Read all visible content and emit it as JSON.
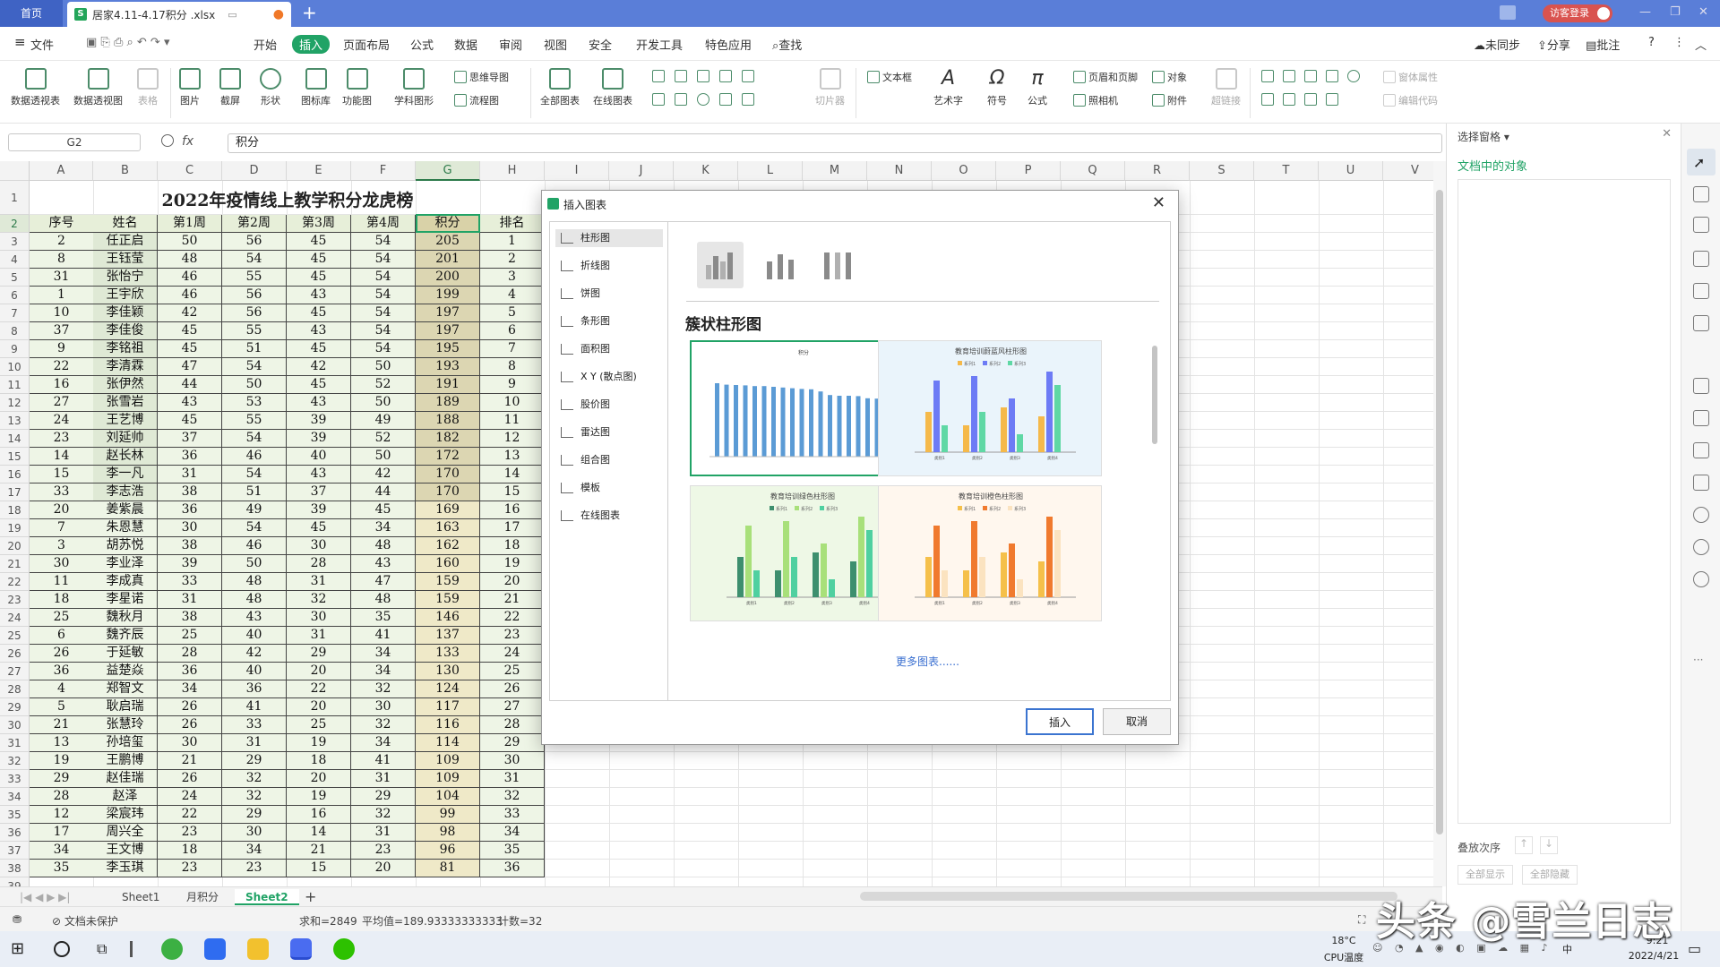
{
  "titlebar": {
    "home_tab": "首页",
    "file_tab": "居家4.11-4.17积分 .xlsx",
    "xls_glyph": "S",
    "login": "访客登录"
  },
  "menu": [
    "文件",
    "开始",
    "插入",
    "页面布局",
    "公式",
    "数据",
    "审阅",
    "视图",
    "安全",
    "开发工具",
    "特色应用",
    "查找"
  ],
  "menu_right": [
    "未同步",
    "分享",
    "批注"
  ],
  "ribbon": {
    "big": [
      "数据透视表",
      "数据透视图",
      "表格",
      "图片",
      "截屏",
      "形状",
      "图标库",
      "功能图",
      "学科图形",
      "全部图表",
      "在线图表",
      "切片器",
      "艺术字",
      "符号",
      "公式",
      "超链接"
    ],
    "small": [
      "思维导图",
      "流程图",
      "文本框",
      "页眉和页脚",
      "照相机",
      "对象",
      "附件",
      "窗体属性",
      "编辑代码"
    ]
  },
  "formula": {
    "namebox": "G2",
    "fx": "fx",
    "value": "积分"
  },
  "sheet": {
    "columns": [
      "A",
      "B",
      "C",
      "D",
      "E",
      "F",
      "G",
      "H",
      "I",
      "J",
      "K",
      "L",
      "M",
      "N",
      "O",
      "P",
      "Q",
      "R",
      "S",
      "T",
      "U",
      "V"
    ],
    "title": "2022年疫情线上教学积分龙虎榜",
    "headers": [
      "序号",
      "姓名",
      "第1周",
      "第2周",
      "第3周",
      "第4周",
      "积分",
      "排名"
    ],
    "rows": [
      [
        "2",
        "任正启",
        "50",
        "56",
        "45",
        "54",
        "205",
        "1"
      ],
      [
        "8",
        "王钰莹",
        "48",
        "54",
        "45",
        "54",
        "201",
        "2"
      ],
      [
        "31",
        "张怡宁",
        "46",
        "55",
        "45",
        "54",
        "200",
        "3"
      ],
      [
        "1",
        "王宇欣",
        "46",
        "56",
        "43",
        "54",
        "199",
        "4"
      ],
      [
        "10",
        "李佳颖",
        "42",
        "56",
        "45",
        "54",
        "197",
        "5"
      ],
      [
        "37",
        "李佳俊",
        "45",
        "55",
        "43",
        "54",
        "197",
        "6"
      ],
      [
        "9",
        "李铭祖",
        "45",
        "51",
        "45",
        "54",
        "195",
        "7"
      ],
      [
        "22",
        "李清霖",
        "47",
        "54",
        "42",
        "50",
        "193",
        "8"
      ],
      [
        "16",
        "张伊然",
        "44",
        "50",
        "45",
        "52",
        "191",
        "9"
      ],
      [
        "27",
        "张雪岩",
        "43",
        "53",
        "43",
        "50",
        "189",
        "10"
      ],
      [
        "24",
        "王艺博",
        "45",
        "55",
        "39",
        "49",
        "188",
        "11"
      ],
      [
        "23",
        "刘延帅",
        "37",
        "54",
        "39",
        "52",
        "182",
        "12"
      ],
      [
        "14",
        "赵长林",
        "36",
        "46",
        "40",
        "50",
        "172",
        "13"
      ],
      [
        "15",
        "李一凡",
        "31",
        "54",
        "43",
        "42",
        "170",
        "14"
      ],
      [
        "33",
        "李志浩",
        "38",
        "51",
        "37",
        "44",
        "170",
        "15"
      ],
      [
        "20",
        "姜紫晨",
        "36",
        "49",
        "39",
        "45",
        "169",
        "16"
      ],
      [
        "7",
        "朱恩慧",
        "30",
        "54",
        "45",
        "34",
        "163",
        "17"
      ],
      [
        "3",
        "胡苏悦",
        "38",
        "46",
        "30",
        "48",
        "162",
        "18"
      ],
      [
        "30",
        "李业泽",
        "39",
        "50",
        "28",
        "43",
        "160",
        "19"
      ],
      [
        "11",
        "李成真",
        "33",
        "48",
        "31",
        "47",
        "159",
        "20"
      ],
      [
        "18",
        "李星诺",
        "31",
        "48",
        "32",
        "48",
        "159",
        "21"
      ],
      [
        "25",
        "魏秋月",
        "38",
        "43",
        "30",
        "35",
        "146",
        "22"
      ],
      [
        "6",
        "魏齐辰",
        "25",
        "40",
        "31",
        "41",
        "137",
        "23"
      ],
      [
        "26",
        "于延敏",
        "28",
        "42",
        "29",
        "34",
        "133",
        "24"
      ],
      [
        "36",
        "益楚焱",
        "36",
        "40",
        "20",
        "34",
        "130",
        "25"
      ],
      [
        "4",
        "郑智文",
        "34",
        "36",
        "22",
        "32",
        "124",
        "26"
      ],
      [
        "5",
        "耿启瑞",
        "26",
        "41",
        "20",
        "30",
        "117",
        "27"
      ],
      [
        "21",
        "张慧玲",
        "26",
        "33",
        "25",
        "32",
        "116",
        "28"
      ],
      [
        "13",
        "孙培玺",
        "30",
        "31",
        "19",
        "34",
        "114",
        "29"
      ],
      [
        "19",
        "王鹏博",
        "21",
        "29",
        "18",
        "41",
        "109",
        "30"
      ],
      [
        "29",
        "赵佳瑞",
        "26",
        "32",
        "20",
        "31",
        "109",
        "31"
      ],
      [
        "28",
        "赵泽",
        "24",
        "32",
        "19",
        "29",
        "104",
        "32"
      ],
      [
        "12",
        "梁宸玮",
        "22",
        "29",
        "16",
        "32",
        "99",
        "33"
      ],
      [
        "17",
        "周兴全",
        "23",
        "30",
        "14",
        "31",
        "98",
        "34"
      ],
      [
        "34",
        "王文博",
        "18",
        "34",
        "21",
        "23",
        "96",
        "35"
      ],
      [
        "35",
        "李玉琪",
        "23",
        "23",
        "15",
        "20",
        "81",
        "36"
      ]
    ]
  },
  "sheet_tabs": [
    "Sheet1",
    "月积分",
    "Sheet2"
  ],
  "status": {
    "protect": "文档未保护",
    "sum": "求和=2849",
    "avg": "平均值=189.93333333333",
    "count": "计数=32"
  },
  "dialog": {
    "title": "插入图表",
    "types": [
      "柱形图",
      "折线图",
      "饼图",
      "条形图",
      "面积图",
      "X Y (散点图)",
      "股价图",
      "雷达图",
      "组合图",
      "模板",
      "在线图表"
    ],
    "heading": "簇状柱形图",
    "more": "更多图表......",
    "insert": "插入",
    "cancel": "取消",
    "templates": [
      {
        "title": "积分",
        "bg": "#ffffff",
        "colors": [
          "#5b9bd5"
        ]
      },
      {
        "title": "教育培训蔚蓝风柱形图",
        "bg": "#eaf4fb",
        "colors": [
          "#f5b94a",
          "#6d7bf5",
          "#5fd8a5"
        ],
        "legend": [
          "系列1",
          "系列2",
          "系列3"
        ],
        "cats": [
          "类别1",
          "类别2",
          "类别3",
          "类别4"
        ]
      },
      {
        "title": "教育培训绿色柱形图",
        "bg": "#eef8e6",
        "colors": [
          "#3d8f6e",
          "#a8e07a",
          "#4fd0a0"
        ],
        "legend": [
          "系列1",
          "系列2",
          "系列3"
        ],
        "cats": [
          "类别1",
          "类别2",
          "类别3",
          "类别4"
        ]
      },
      {
        "title": "教育培训橙色柱形图",
        "bg": "#fff7ee",
        "colors": [
          "#f5c04a",
          "#f07a2e",
          "#fbe3c0"
        ],
        "legend": [
          "系列1",
          "系列2",
          "系列3"
        ],
        "cats": [
          "类别1",
          "类别2",
          "类别3",
          "类别4"
        ]
      }
    ]
  },
  "right_pane": {
    "title": "选择窗格",
    "sub": "文档中的对象",
    "order": "叠放次序",
    "show_all": "全部显示",
    "hide_all": "全部隐藏"
  },
  "taskbar": {
    "temp": "18°C",
    "cpu": "CPU温度",
    "time": "9:21",
    "date": "2022/4/21",
    "ime": "中"
  },
  "watermark": "头条 @雪兰日志"
}
